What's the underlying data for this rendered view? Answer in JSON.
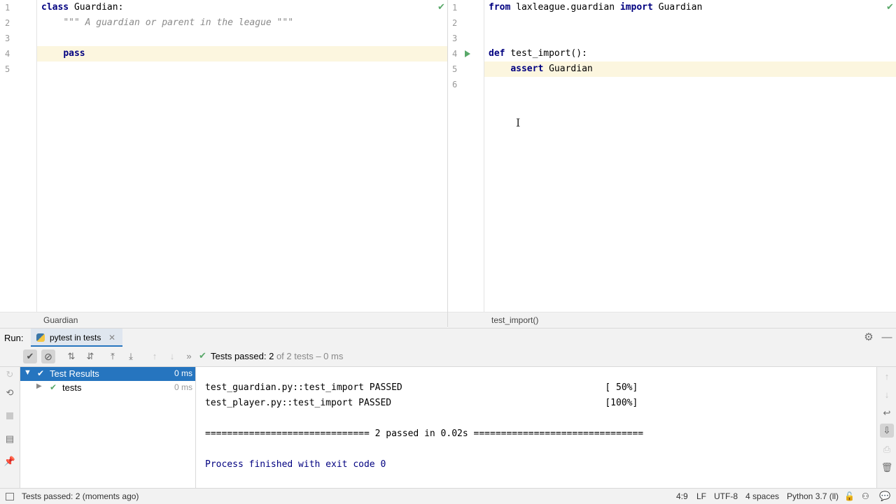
{
  "left_editor": {
    "lines": [
      {
        "num": "1",
        "tokens": [
          {
            "t": "class",
            "c": "kw"
          },
          {
            "t": " Guardian:",
            "c": ""
          }
        ]
      },
      {
        "num": "2",
        "tokens": [
          {
            "t": "    ",
            "c": ""
          },
          {
            "t": "\"\"\" A guardian or parent in the league \"\"\"",
            "c": "doc"
          }
        ]
      },
      {
        "num": "3",
        "tokens": []
      },
      {
        "num": "4",
        "tokens": [
          {
            "t": "    ",
            "c": ""
          },
          {
            "t": "pass",
            "c": "kw"
          }
        ]
      },
      {
        "num": "5",
        "tokens": []
      }
    ],
    "breadcrumb": "Guardian"
  },
  "right_editor": {
    "lines": [
      {
        "num": "1",
        "tokens": [
          {
            "t": "from",
            "c": "kw"
          },
          {
            "t": " laxleague.guardian ",
            "c": ""
          },
          {
            "t": "import",
            "c": "kw"
          },
          {
            "t": " Guardian",
            "c": ""
          }
        ]
      },
      {
        "num": "2",
        "tokens": []
      },
      {
        "num": "3",
        "tokens": []
      },
      {
        "num": "4",
        "tokens": [
          {
            "t": "def",
            "c": "kw"
          },
          {
            "t": " test_import():",
            "c": ""
          }
        ]
      },
      {
        "num": "5",
        "tokens": [
          {
            "t": "    ",
            "c": ""
          },
          {
            "t": "assert",
            "c": "kw"
          },
          {
            "t": " Guardian",
            "c": ""
          }
        ]
      },
      {
        "num": "6",
        "tokens": []
      }
    ],
    "breadcrumb": "test_import()"
  },
  "run": {
    "label": "Run:",
    "tab_label": "pytest in tests",
    "summary_passed": "Tests passed: 2",
    "summary_rest": "of 2 tests – 0 ms",
    "tree": [
      {
        "label": "Test Results",
        "time": "0 ms"
      },
      {
        "label": "tests",
        "time": "0 ms"
      }
    ],
    "console_lines": [
      "test_guardian.py::test_import PASSED                                     [ 50%]",
      "test_player.py::test_import PASSED                                       [100%]",
      "",
      "============================== 2 passed in 0.02s ===============================",
      "",
      "Process finished with exit code 0"
    ]
  },
  "status": {
    "message": "Tests passed: 2 (moments ago)",
    "position": "4:9",
    "line_sep": "LF",
    "encoding": "UTF-8",
    "indent": "4 spaces",
    "interpreter": "Python 3.7 (ll)"
  },
  "colors": {
    "accent": "#2675bf",
    "pass_green": "#59a869",
    "keyword": "#000080",
    "highlight_line": "#fcf6df"
  }
}
